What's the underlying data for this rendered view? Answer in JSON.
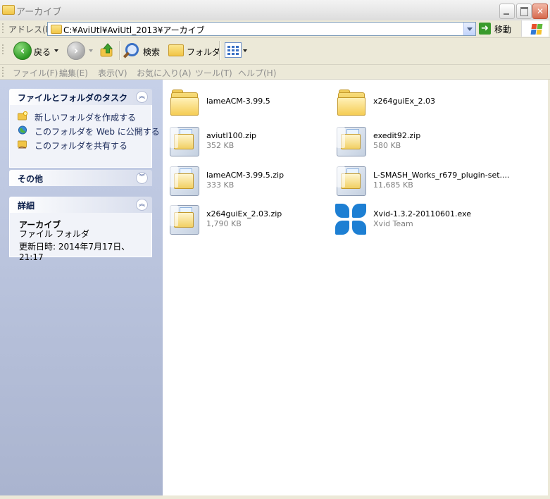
{
  "window": {
    "title": "アーカイブ"
  },
  "address_bar": {
    "label": "アドレス(D)",
    "path": "C:¥AviUtl¥AviUtl_2013¥アーカイブ",
    "go_label": "移動"
  },
  "toolbar": {
    "back_label": "戻る",
    "search_label": "検索",
    "folders_label": "フォルダ"
  },
  "menu": {
    "items": [
      "ファイル(F)",
      "編集(E)",
      "表示(V)",
      "お気に入り(A)",
      "ツール(T)",
      "ヘルプ(H)"
    ]
  },
  "task_pane": {
    "tasks_panel": {
      "title": "ファイルとフォルダのタスク",
      "tasks": [
        {
          "label": "新しいフォルダを作成する",
          "icon": "new-folder-icon"
        },
        {
          "label": "このフォルダを Web に公開する",
          "icon": "web-publish-icon"
        },
        {
          "label": "このフォルダを共有する",
          "icon": "share-folder-icon"
        }
      ]
    },
    "other_panel": {
      "title": "その他"
    },
    "details_panel": {
      "title": "詳細",
      "name": "アーカイブ",
      "type": "ファイル フォルダ",
      "modified": "更新日時: 2014年7月17日、21:17"
    }
  },
  "files": [
    {
      "name": "lameACM-3.99.5",
      "sub": "",
      "icon": "folder-icon"
    },
    {
      "name": "x264guiEx_2.03",
      "sub": "",
      "icon": "folder-icon"
    },
    {
      "name": "aviutl100.zip",
      "sub": "352 KB",
      "icon": "zip-icon"
    },
    {
      "name": "exedit92.zip",
      "sub": "580 KB",
      "icon": "zip-icon"
    },
    {
      "name": "lameACM-3.99.5.zip",
      "sub": "333 KB",
      "icon": "zip-icon"
    },
    {
      "name": "L-SMASH_Works_r679_plugin-set....",
      "sub": "11,685 KB",
      "icon": "zip-icon"
    },
    {
      "name": "x264guiEx_2.03.zip",
      "sub": "1,790 KB",
      "icon": "zip-icon"
    },
    {
      "name": "Xvid-1.3.2-20110601.exe",
      "sub": "Xvid Team",
      "icon": "xvid-icon"
    }
  ],
  "colors": {
    "task_pane": "#c6d0e8",
    "xvid_blue": "#1d7fd3",
    "folder_yellow": "#f1c546"
  }
}
